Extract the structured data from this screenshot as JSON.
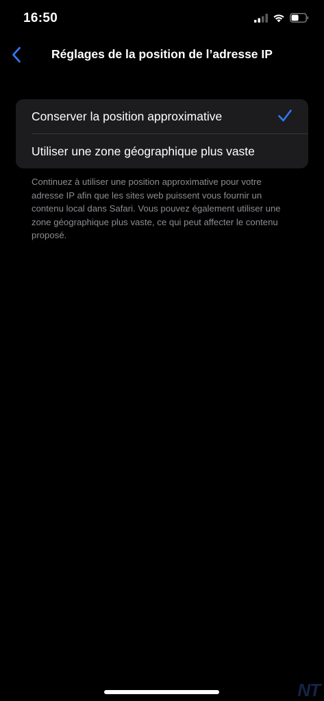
{
  "status_bar": {
    "time": "16:50",
    "signal_icon": "cellular-signal-icon",
    "wifi_icon": "wifi-icon",
    "battery_icon": "battery-icon"
  },
  "nav": {
    "back_icon": "chevron-left-icon",
    "title": "Réglages de la position de l’adresse IP"
  },
  "options": [
    {
      "label": "Conserver la position approximative",
      "selected": true
    },
    {
      "label": "Utiliser une zone géographique plus vaste",
      "selected": false
    }
  ],
  "footer_note": "Continuez à utiliser une position approximative pour votre adresse IP afin que les sites web puissent vous fournir un contenu local dans Safari. Vous pouvez également utiliser une zone géographique plus vaste, ce qui peut affecter le contenu proposé.",
  "watermark": "NT",
  "colors": {
    "accent": "#3478f6",
    "background": "#000000",
    "group_background": "#1c1c1e",
    "secondary_text": "#8d8d93"
  }
}
